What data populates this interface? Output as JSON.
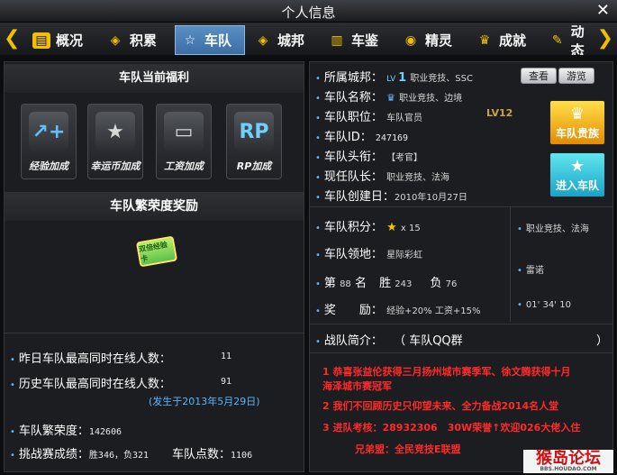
{
  "window": {
    "title": "个人信息",
    "close": "✕"
  },
  "nav": {
    "prev": "❮",
    "next": "❯",
    "tabs": [
      {
        "label": "概况",
        "icon": "▤"
      },
      {
        "label": "积累",
        "icon": "◈"
      },
      {
        "label": "车队",
        "icon": "☆"
      },
      {
        "label": "城邦",
        "icon": "◈"
      },
      {
        "label": "车鉴",
        "icon": "▥"
      },
      {
        "label": "精灵",
        "icon": "◉"
      },
      {
        "label": "成就",
        "icon": "♛"
      },
      {
        "label": "动态",
        "icon": "✎"
      }
    ]
  },
  "left": {
    "benefits_title": "车队当前福利",
    "bonuses": [
      {
        "label": "经验加成",
        "icon": "↗+"
      },
      {
        "label": "幸运币加成",
        "icon": "★"
      },
      {
        "label": "工资加成",
        "icon": "▭"
      },
      {
        "label": "RP加成",
        "icon": "RP"
      }
    ],
    "prosperity_title": "车队繁荣度奖励",
    "card_text": "双倍经验卡",
    "stats": {
      "yesterday_label": "昨日车队最高同时在线人数：",
      "yesterday_value": "11",
      "history_label": "历史车队最高同时在线人数：",
      "history_value": "91",
      "history_date": "(发生于2013年5月29日)",
      "prosperity_label": "车队繁荣度：",
      "prosperity_value": "142606",
      "challenge_label": "挑战赛成绩：",
      "challenge_value": "胜346，负321",
      "points_label": "车队点数：",
      "points_value": "1106"
    }
  },
  "right": {
    "info": {
      "city_label": "所属城邦：",
      "city_lv": "LV",
      "city_level": "1",
      "city_name": "职业竞技、SSC",
      "view_btn": "查看",
      "tour_btn": "游览",
      "name_label": "车队名称：",
      "name_value": "职业竞技、边境",
      "position_label": "车队职位：",
      "position_value": "车队官员",
      "level": "LV12",
      "id_label": "车队ID：",
      "id_value": "247169",
      "title_label": "车队头衔：",
      "title_value": "【考官】",
      "captain_label": "现任队长：",
      "captain_value": "职业竞技、法海",
      "created_label": "车队创建日：",
      "created_value": "2010年10月27日",
      "noble_btn": "车队贵族",
      "enter_btn": "进入车队"
    },
    "stats": {
      "score_label": "车队积分：",
      "score_value": "x 15",
      "territory_label": "车队领地：",
      "territory_value": "星际彩虹",
      "rank_prefix": "第",
      "rank_value": "88",
      "rank_suffix": "名",
      "win_label": "胜",
      "win_value": "243",
      "loss_label": "负",
      "loss_value": "76",
      "reward_label": "奖　　励：",
      "reward_value": "经验+20% 工资+15%",
      "side1": "职业竞技、法海",
      "side2": "雷诺",
      "side3": "01' 34' 10"
    },
    "intro": {
      "label": "战队简介：",
      "value": "（ 车队QQ群",
      "close_paren": "）",
      "lines": [
        "1 恭喜张益伦获得三月扬州城市赛季军、徐文腾获得十月",
        "海泽城市赛冠军",
        "2 我们不回顾历史只仰望未来、全力备战2014名人堂",
        "3 进队考核：28932306　30W荣誉↑欢迎026大佬入住",
        "兄弟盟：全民竞技E联盟"
      ]
    },
    "watermark": "猴岛论坛",
    "watermark_sub": "BBS.HOUDAO.COM"
  }
}
